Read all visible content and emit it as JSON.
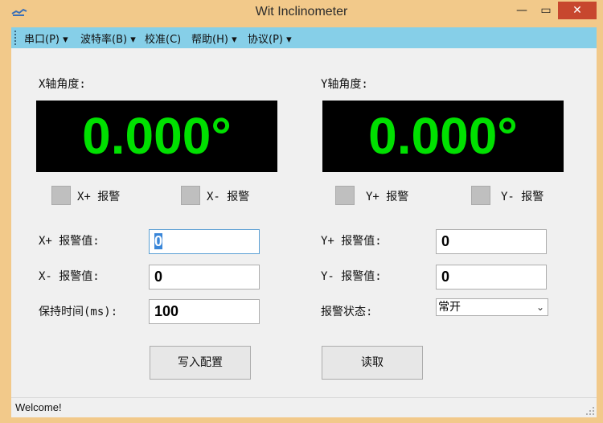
{
  "window": {
    "title": "Wit Inclinometer",
    "minimize": "—",
    "maximize": "▭",
    "close": "✕"
  },
  "menu": [
    {
      "label": "串口(P)",
      "arrow": "▾"
    },
    {
      "label": "波特率(B)",
      "arrow": "▾"
    },
    {
      "label": "校准(C)",
      "arrow": ""
    },
    {
      "label": "帮助(H)",
      "arrow": "▾"
    },
    {
      "label": "协议(P)",
      "arrow": "▾"
    }
  ],
  "x_axis": {
    "label": "X轴角度:",
    "value": "0.000°",
    "alarm_plus_label": "X+ 报警",
    "alarm_minus_label": "X- 报警"
  },
  "y_axis": {
    "label": "Y轴角度:",
    "value": "0.000°",
    "alarm_plus_label": "Y+ 报警",
    "alarm_minus_label": "Y- 报警"
  },
  "fields": {
    "x_plus_label": "X+ 报警值:",
    "x_plus_value": "0",
    "x_minus_label": "X- 报警值:",
    "x_minus_value": "0",
    "hold_label": "保持时间(ms):",
    "hold_value": "100",
    "y_plus_label": "Y+ 报警值:",
    "y_plus_value": "0",
    "y_minus_label": "Y- 报警值:",
    "y_minus_value": "0",
    "alarm_state_label": "报警状态:",
    "alarm_state_value": "常开"
  },
  "buttons": {
    "write": "写入配置",
    "read": "读取"
  },
  "status": {
    "text": "Welcome!"
  },
  "colors": {
    "titlebar": "#f2c98a",
    "menubar": "#86cfe8",
    "display_bg": "#000000",
    "display_fg": "#00e000",
    "close": "#c7472e"
  }
}
